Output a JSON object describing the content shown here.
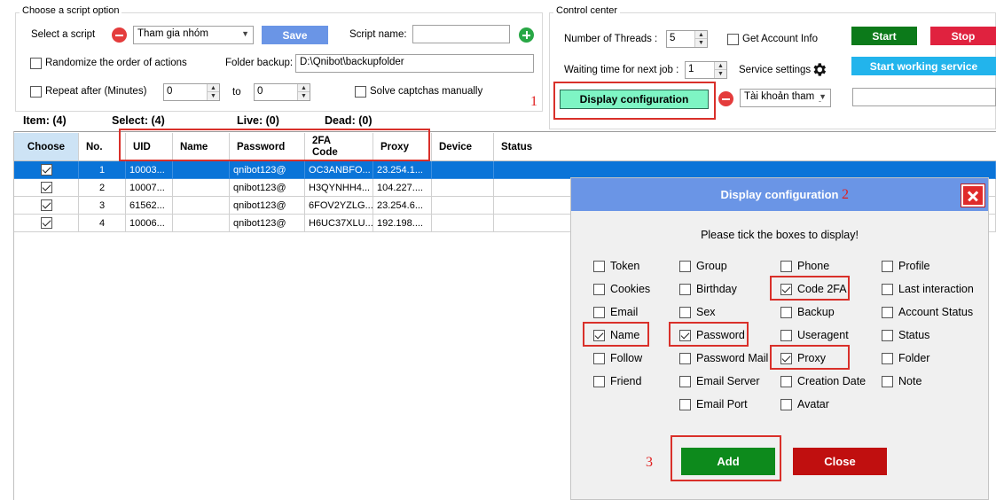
{
  "script_option": {
    "legend": "Choose a script option",
    "select_script_label": "Select a script",
    "selected_script": "Tham gia nhóm",
    "save_label": "Save",
    "script_name_label": "Script name:",
    "script_name_value": "",
    "randomize_label": "Randomize the order of actions",
    "randomize_checked": false,
    "folder_backup_label": "Folder backup:",
    "folder_backup_value": "D:\\Qnibot\\backupfolder",
    "repeat_label": "Repeat after (Minutes)",
    "repeat_checked": false,
    "repeat_from": "0",
    "to_label": "to",
    "repeat_to": "0",
    "solve_captcha_label": "Solve captchas manually",
    "solve_captcha_checked": false
  },
  "control_center": {
    "legend": "Control center",
    "threads_label": "Number of Threads :",
    "threads_value": "5",
    "get_account_info_label": "Get Account Info",
    "get_account_info_checked": false,
    "start_label": "Start",
    "stop_label": "Stop",
    "waiting_label": "Waiting time for next job :",
    "waiting_value": "1",
    "service_settings_label": "Service settings",
    "start_working_label": "Start working service",
    "display_config_label": "Display configuration",
    "account_combo_value": "Tài khoản tham g",
    "right_input_value": ""
  },
  "stats": {
    "item": "Item: (4)",
    "select": "Select: (4)",
    "live": "Live: (0)",
    "dead": "Dead: (0)"
  },
  "table": {
    "columns": [
      "Choose",
      "No.",
      "UID",
      "Name",
      "Password",
      "2FA Code",
      "Proxy",
      "Device",
      "Status"
    ],
    "rows": [
      {
        "checked": true,
        "no": "1",
        "uid": "10003...",
        "name": "",
        "password": "qnibot123@",
        "code": "OC3ANBFO...",
        "proxy": "23.254.1...",
        "selected": true
      },
      {
        "checked": true,
        "no": "2",
        "uid": "10007...",
        "name": "",
        "password": "qnibot123@",
        "code": "H3QYNHH4...",
        "proxy": "104.227....",
        "selected": false
      },
      {
        "checked": true,
        "no": "3",
        "uid": "61562...",
        "name": "",
        "password": "qnibot123@",
        "code": "6FOV2YZLG...",
        "proxy": "23.254.6...",
        "selected": false
      },
      {
        "checked": true,
        "no": "4",
        "uid": "10006...",
        "name": "",
        "password": "qnibot123@",
        "code": "H6UC37XLU...",
        "proxy": "192.198....",
        "selected": false
      }
    ]
  },
  "dialog": {
    "title": "Display configuration",
    "instruction": "Please tick the boxes to display!",
    "columns": [
      [
        {
          "label": "Token",
          "checked": false
        },
        {
          "label": "Cookies",
          "checked": false
        },
        {
          "label": "Email",
          "checked": false
        },
        {
          "label": "Name",
          "checked": true
        },
        {
          "label": "Follow",
          "checked": false
        },
        {
          "label": "Friend",
          "checked": false
        }
      ],
      [
        {
          "label": "Group",
          "checked": false
        },
        {
          "label": "Birthday",
          "checked": false
        },
        {
          "label": "Sex",
          "checked": false
        },
        {
          "label": "Password",
          "checked": true
        },
        {
          "label": "Password Mail",
          "checked": false
        },
        {
          "label": "Email Server",
          "checked": false
        },
        {
          "label": "Email Port",
          "checked": false
        }
      ],
      [
        {
          "label": "Phone",
          "checked": false
        },
        {
          "label": "Code 2FA",
          "checked": true
        },
        {
          "label": "Backup",
          "checked": false
        },
        {
          "label": "Useragent",
          "checked": false
        },
        {
          "label": "Proxy",
          "checked": true
        },
        {
          "label": "Creation Date",
          "checked": false
        },
        {
          "label": "Avatar",
          "checked": false
        }
      ],
      [
        {
          "label": "Profile",
          "checked": false
        },
        {
          "label": "Last interaction",
          "checked": false
        },
        {
          "label": "Account Status",
          "checked": false
        },
        {
          "label": "Status",
          "checked": false
        },
        {
          "label": "Folder",
          "checked": false
        },
        {
          "label": "Note",
          "checked": false
        }
      ]
    ],
    "add_label": "Add",
    "close_label": "Close"
  },
  "annotations": {
    "n1": "1",
    "n2": "2",
    "n3": "3"
  },
  "colors": {
    "save_button": "#6a95e6",
    "start_button": "#0c7a1a",
    "stop_button": "#e0223f",
    "start_working_button": "#22b4ec",
    "display_config_button": "#7ef5c4",
    "add_button": "#0d8a1c",
    "close_button": "#c00f0f",
    "dialog_header": "#6a95e6",
    "selected_row": "#0a74d8",
    "annotation_red": "#d9302a"
  }
}
